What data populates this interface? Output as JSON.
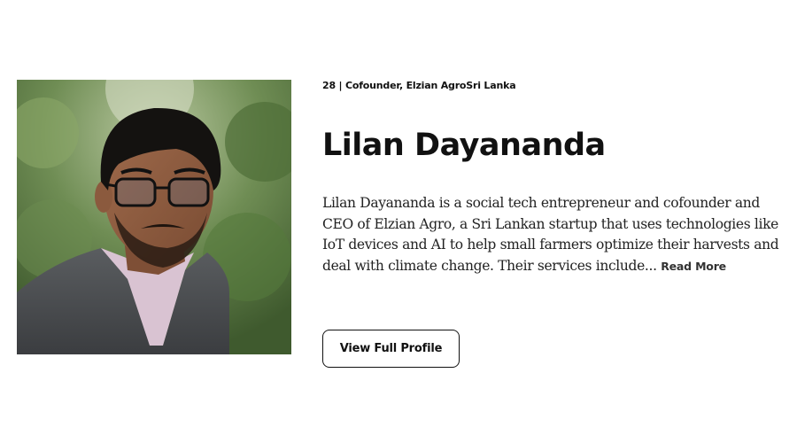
{
  "profile": {
    "meta": "28 | Cofounder, Elzian AgroSri Lanka",
    "name": "Lilan Dayananda",
    "bio": "Lilan Dayananda is a social tech entrepreneur and cofounder and CEO of Elzian Agro, a Sri Lankan startup that uses technologies like IoT devices and AI to help small farmers optimize their harvests and deal with climate change. Their services include",
    "ellipsis": "...",
    "read_more_label": "Read More",
    "view_profile_label": "View Full Profile",
    "photo_alt": "Lilan Dayananda"
  }
}
